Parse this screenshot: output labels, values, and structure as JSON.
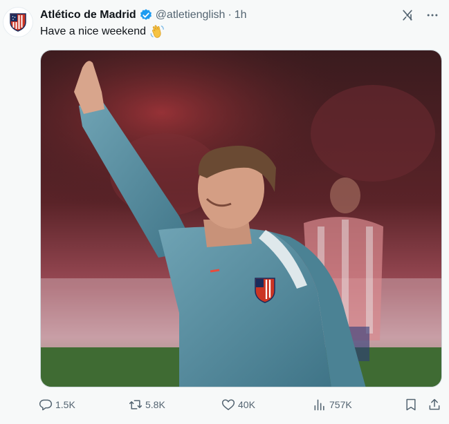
{
  "tweet": {
    "display_name": "Atlético de Madrid",
    "handle": "@atletienglish",
    "separator": "·",
    "time": "1h",
    "text": "Have a nice weekend",
    "emoji": "waving-hand",
    "verified": true
  },
  "icons": {
    "avatar": "atletico-crest-icon",
    "verified": "verified-badge-icon",
    "grok": "grok-icon",
    "more": "more-icon",
    "reply": "reply-icon",
    "retweet": "retweet-icon",
    "like": "heart-icon",
    "views": "views-icon",
    "bookmark": "bookmark-icon",
    "share": "share-icon"
  },
  "actions": {
    "replies": "1.5K",
    "retweets": "5.8K",
    "likes": "40K",
    "views": "757K"
  },
  "colors": {
    "accent": "#1d9bf0",
    "text": "#0f1419",
    "secondary": "#536471",
    "background": "#f7f9f9"
  }
}
